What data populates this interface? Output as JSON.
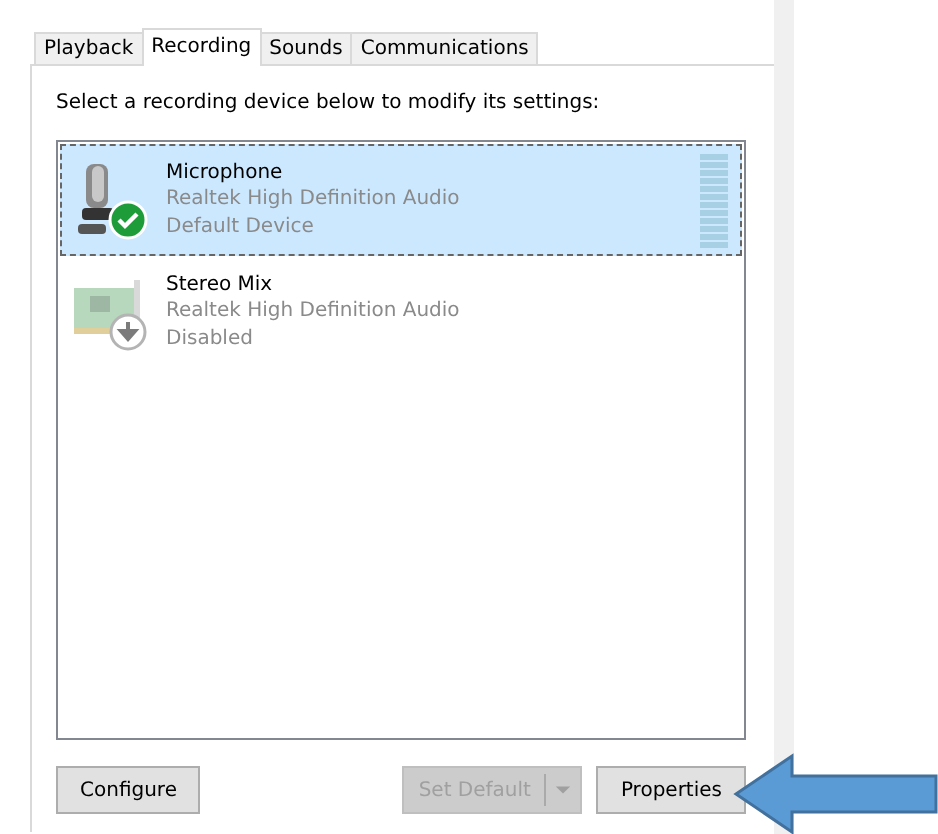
{
  "tabs": [
    {
      "label": "Playback",
      "selected": false
    },
    {
      "label": "Recording",
      "selected": true
    },
    {
      "label": "Sounds",
      "selected": false
    },
    {
      "label": "Communications",
      "selected": false
    }
  ],
  "instruction": "Select a recording device below to modify its settings:",
  "devices": [
    {
      "name": "Microphone",
      "driver": "Realtek High Definition Audio",
      "status": "Default Device",
      "kind": "microphone",
      "default": true,
      "selected": true,
      "disabled": false
    },
    {
      "name": "Stereo Mix",
      "driver": "Realtek High Definition Audio",
      "status": "Disabled",
      "kind": "sound-card",
      "default": false,
      "selected": false,
      "disabled": true
    }
  ],
  "buttons": {
    "configure": {
      "label": "Configure"
    },
    "set_default": {
      "label": "Set Default",
      "disabled": true
    },
    "properties": {
      "label": "Properties"
    }
  },
  "callout_arrow": true
}
